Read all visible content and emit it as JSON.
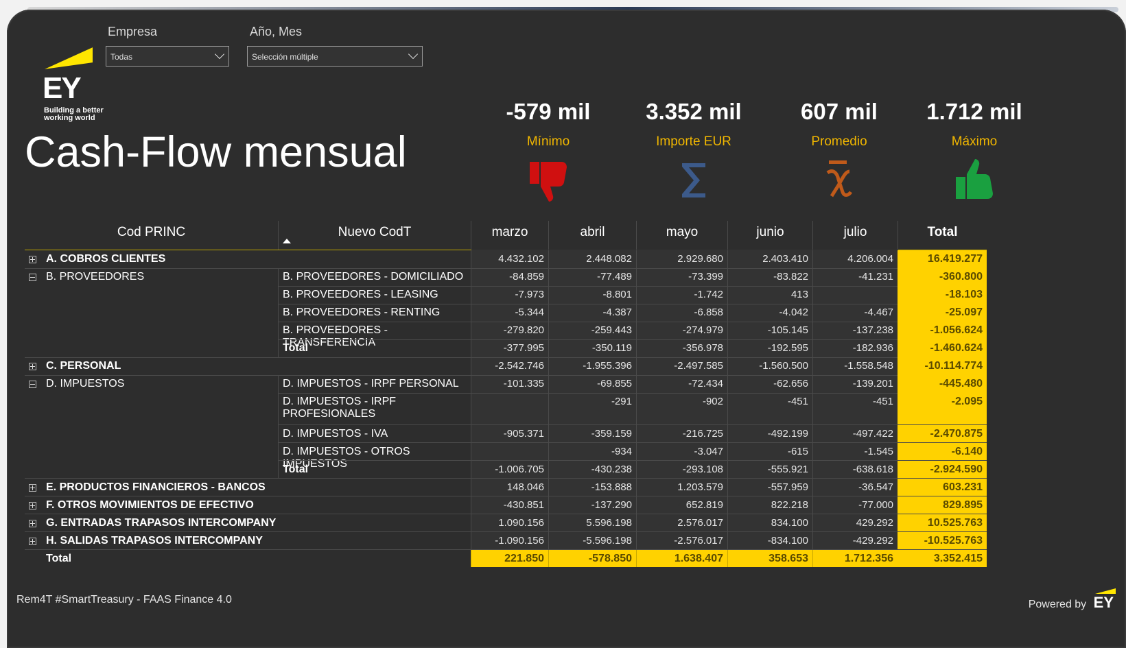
{
  "logo": {
    "text": "EY",
    "tagline_1": "Building a better",
    "tagline_2": "working world"
  },
  "filters": {
    "empresa": {
      "label": "Empresa",
      "value": "Todas"
    },
    "anio_mes": {
      "label": "Año, Mes",
      "value": "Selección múltiple"
    }
  },
  "title": "Cash-Flow mensual",
  "kpis": [
    {
      "value": "-579 mil",
      "label": "Mínimo",
      "icon": "thumbs-down-icon",
      "color": "#d01010"
    },
    {
      "value": "3.352 mil",
      "label": "Importe EUR",
      "icon": "sigma-icon",
      "color": "#3c5a8a"
    },
    {
      "value": "607 mil",
      "label": "Promedio",
      "icon": "mean-icon",
      "color": "#c05a1a"
    },
    {
      "value": "1.712 mil",
      "label": "Máximo",
      "icon": "thumbs-up-icon",
      "color": "#1aa040"
    }
  ],
  "table": {
    "headers": {
      "cod": "Cod PRINC",
      "nuevo": "Nuevo CodT",
      "months": [
        "marzo",
        "abril",
        "mayo",
        "junio",
        "julio"
      ],
      "total": "Total"
    },
    "rows": [
      {
        "cat": "A. COBROS CLIENTES",
        "bold": true,
        "exp": "plus",
        "sub": "",
        "vals": [
          "4.432.102",
          "2.448.082",
          "2.929.680",
          "2.403.410",
          "4.206.004"
        ],
        "total": "16.419.277"
      },
      {
        "cat": "B. PROVEEDORES",
        "bold": false,
        "exp": "minus",
        "sub": "B. PROVEEDORES - DOMICILIADO",
        "vals": [
          "-84.859",
          "-77.489",
          "-73.399",
          "-83.822",
          "-41.231"
        ],
        "total": "-360.800"
      },
      {
        "cat": "",
        "sub": "B. PROVEEDORES - LEASING",
        "vals": [
          "-7.973",
          "-8.801",
          "-1.742",
          "413",
          ""
        ],
        "total": "-18.103"
      },
      {
        "cat": "",
        "sub": "B. PROVEEDORES - RENTING",
        "vals": [
          "-5.344",
          "-4.387",
          "-6.858",
          "-4.042",
          "-4.467"
        ],
        "total": "-25.097"
      },
      {
        "cat": "",
        "sub": "B. PROVEEDORES - TRANSFERENCIA",
        "vals": [
          "-279.820",
          "-259.443",
          "-274.979",
          "-105.145",
          "-137.238"
        ],
        "total": "-1.056.624"
      },
      {
        "cat": "",
        "sub": "Total",
        "subBold": true,
        "vals": [
          "-377.995",
          "-350.119",
          "-356.978",
          "-192.595",
          "-182.936"
        ],
        "total": "-1.460.624"
      },
      {
        "cat": "C. PERSONAL",
        "bold": true,
        "exp": "plus",
        "sub": "",
        "vals": [
          "-2.542.746",
          "-1.955.396",
          "-2.497.585",
          "-1.560.500",
          "-1.558.548"
        ],
        "total": "-10.114.774"
      },
      {
        "cat": "D. IMPUESTOS",
        "bold": false,
        "exp": "minus",
        "sub": "D. IMPUESTOS - IRPF PERSONAL",
        "vals": [
          "-101.335",
          "-69.855",
          "-72.434",
          "-62.656",
          "-139.201"
        ],
        "total": "-445.480"
      },
      {
        "cat": "",
        "sub": "D. IMPUESTOS - IRPF PROFESIONALES",
        "tall": true,
        "vals": [
          "",
          "-291",
          "-902",
          "-451",
          "-451"
        ],
        "total": "-2.095"
      },
      {
        "cat": "",
        "sub": "D. IMPUESTOS - IVA",
        "vals": [
          "-905.371",
          "-359.159",
          "-216.725",
          "-492.199",
          "-497.422"
        ],
        "total": "-2.470.875"
      },
      {
        "cat": "",
        "sub": "D. IMPUESTOS - OTROS IMPUESTOS",
        "vals": [
          "",
          "-934",
          "-3.047",
          "-615",
          "-1.545"
        ],
        "total": "-6.140"
      },
      {
        "cat": "",
        "sub": "Total",
        "subBold": true,
        "vals": [
          "-1.006.705",
          "-430.238",
          "-293.108",
          "-555.921",
          "-638.618"
        ],
        "total": "-2.924.590"
      },
      {
        "cat": "E. PRODUCTOS FINANCIEROS - BANCOS",
        "bold": true,
        "exp": "plus",
        "sub": "",
        "vals": [
          "148.046",
          "-153.888",
          "1.203.579",
          "-557.959",
          "-36.547"
        ],
        "total": "603.231"
      },
      {
        "cat": "F. OTROS MOVIMIENTOS DE EFECTIVO",
        "bold": true,
        "exp": "plus",
        "sub": "",
        "vals": [
          "-430.851",
          "-137.290",
          "652.819",
          "822.218",
          "-77.000"
        ],
        "total": "829.895"
      },
      {
        "cat": "G. ENTRADAS TRAPASOS INTERCOMPANY",
        "bold": true,
        "exp": "plus",
        "sub": "",
        "vals": [
          "1.090.156",
          "5.596.198",
          "2.576.017",
          "834.100",
          "429.292"
        ],
        "total": "10.525.763"
      },
      {
        "cat": "H. SALIDAS TRAPASOS INTERCOMPANY",
        "bold": true,
        "exp": "plus",
        "sub": "",
        "vals": [
          "-1.090.156",
          "-5.596.198",
          "-2.576.017",
          "-834.100",
          "-429.292"
        ],
        "total": "-10.525.763"
      }
    ],
    "grand_total": {
      "label": "Total",
      "vals": [
        "221.850",
        "-578.850",
        "1.638.407",
        "358.653",
        "1.712.356"
      ],
      "total": "3.352.415"
    }
  },
  "footer": {
    "left": "Rem4T #SmartTreasury - FAAS Finance 4.0",
    "right": "Powered by",
    "right_logo": "EY"
  }
}
